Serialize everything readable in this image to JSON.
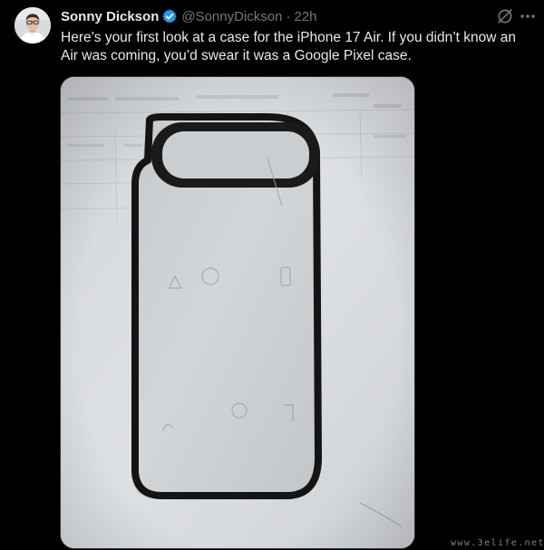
{
  "tweet": {
    "author": {
      "display_name": "Sonny Dickson",
      "handle": "@SonnyDickson",
      "verified": true
    },
    "separator": "·",
    "timestamp": "22h",
    "text": "Here’s your first look at a case for the iPhone 17 Air. If you didn’t know an Air was coming, you’d swear it was a Google Pixel case.",
    "media": {
      "type": "photo"
    },
    "watermark": "www.3elife.net"
  },
  "colors": {
    "background": "#000000",
    "text_primary": "#e7e9ea",
    "text_secondary": "#71767b",
    "verified_badge": "#1d9bf0"
  },
  "icons": {
    "verified": "verified-badge-icon",
    "grok": "grok-slash-circle-icon",
    "more": "more-horizontal-dots-icon"
  }
}
